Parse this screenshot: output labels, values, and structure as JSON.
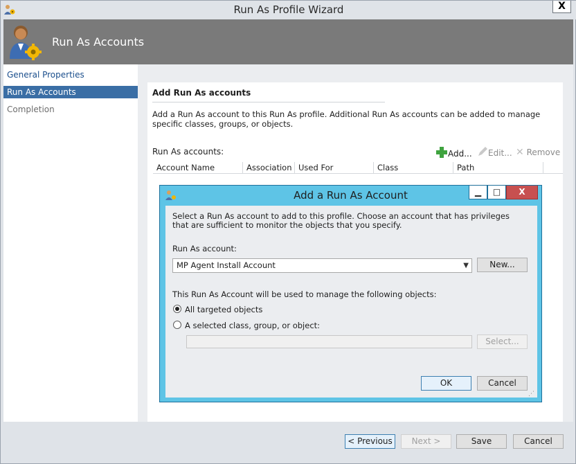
{
  "window": {
    "title": "Run As Profile Wizard",
    "close_glyph": "X"
  },
  "header": {
    "title": "Run As Accounts"
  },
  "nav": {
    "items": [
      "General Properties",
      "Run As Accounts",
      "Completion"
    ]
  },
  "page": {
    "section_title": "Add Run As accounts",
    "description": "Add a Run As account to this Run As profile.  Additional Run As accounts can be added to manage specific classes, groups, or objects.",
    "accounts_label": "Run As accounts:",
    "toolbar": {
      "add": "Add...",
      "edit": "Edit...",
      "remove": "Remove"
    },
    "columns": [
      "Account Name",
      "Association",
      "Used For",
      "Class",
      "Path"
    ]
  },
  "dialog": {
    "title": "Add a Run As Account",
    "min_glyph": "▁",
    "max_glyph": "□",
    "close_glyph": "X",
    "intro": "Select a Run As account to add to this profile.  Choose an account that has privileges that are sufficient to monitor the objects that you specify.",
    "account_label": "Run As account:",
    "account_value": "MP Agent Install Account",
    "new_button": "New...",
    "scope_label": "This Run As Account will be used to manage the following objects:",
    "radio_all": "All targeted objects",
    "radio_selected": "A selected class, group, or object:",
    "select_button": "Select...",
    "ok": "OK",
    "cancel": "Cancel"
  },
  "footer": {
    "previous": "< Previous",
    "next": "Next >",
    "save": "Save",
    "cancel": "Cancel"
  },
  "colors": {
    "header_band": "#7a7a7a",
    "nav_selected": "#3a6ea5",
    "dialog_frame": "#5ec4e6",
    "dialog_close": "#c75050",
    "add_icon": "#3fa33f"
  }
}
